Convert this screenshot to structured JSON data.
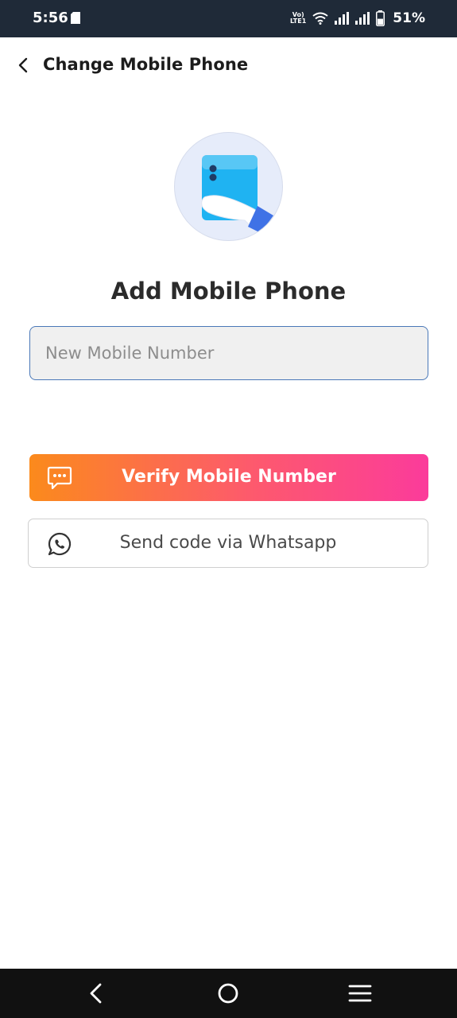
{
  "status_bar": {
    "time": "5:56",
    "network_label": "VoLTE1",
    "battery_percent": "51%",
    "battery_level": 0.51
  },
  "header": {
    "title": "Change Mobile Phone"
  },
  "main": {
    "heading": "Add Mobile Phone",
    "phone_input": {
      "value": "",
      "placeholder": "New Mobile Number"
    },
    "verify_button": {
      "label": "Verify Mobile Number",
      "icon": "chat-bubble-icon"
    },
    "whatsapp_button": {
      "label": "Send code via Whatsapp",
      "icon": "whatsapp-icon"
    }
  },
  "nav_bar": {
    "items": [
      "back",
      "home",
      "recents"
    ]
  },
  "colors": {
    "status_bar_bg": "#1f2a38",
    "input_border": "#4a78b8",
    "gradient_start": "#fb8a1c",
    "gradient_end": "#fb3b9b",
    "illustration_blue": "#1fb3f2"
  }
}
